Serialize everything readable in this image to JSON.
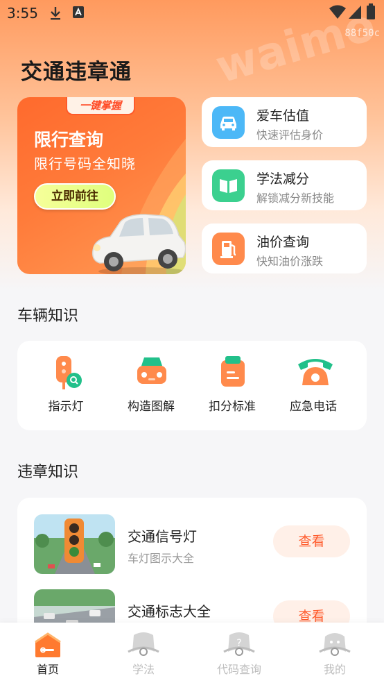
{
  "status_bar": {
    "time": "3:55",
    "watermark_code": "88f50c",
    "watermark_text": "waimo"
  },
  "app": {
    "title": "交通违章通"
  },
  "promo": {
    "tag": "一键掌握",
    "title": "限行查询",
    "subtitle": "限行号码全知晓",
    "button": "立即前往"
  },
  "features": [
    {
      "title": "爱车估值",
      "subtitle": "快速评估身价",
      "icon": "car-icon",
      "color": "#4cb8f7"
    },
    {
      "title": "学法减分",
      "subtitle": "解锁减分新技能",
      "icon": "book-icon",
      "color": "#3bd08f"
    },
    {
      "title": "油价查询",
      "subtitle": "快知油价涨跌",
      "icon": "fuel-pump-icon",
      "color": "#ff8a4c"
    }
  ],
  "vehicle_knowledge": {
    "title": "车辆知识",
    "items": [
      {
        "label": "指示灯",
        "icon": "indicator-light-icon"
      },
      {
        "label": "构造图解",
        "icon": "car-structure-icon"
      },
      {
        "label": "扣分标准",
        "icon": "clipboard-icon"
      },
      {
        "label": "应急电话",
        "icon": "phone-icon"
      }
    ]
  },
  "violation_knowledge": {
    "title": "违章知识",
    "items": [
      {
        "title": "交通信号灯",
        "subtitle": "车灯图示大全",
        "button": "查看"
      },
      {
        "title": "交通标志大全",
        "subtitle": "",
        "button": "查看"
      }
    ]
  },
  "tabs": [
    {
      "label": "首页",
      "active": true
    },
    {
      "label": "学法",
      "active": false
    },
    {
      "label": "代码查询",
      "active": false
    },
    {
      "label": "我的",
      "active": false
    }
  ],
  "colors": {
    "accent": "#ff5a2b",
    "hero": "#ff9a5e"
  }
}
